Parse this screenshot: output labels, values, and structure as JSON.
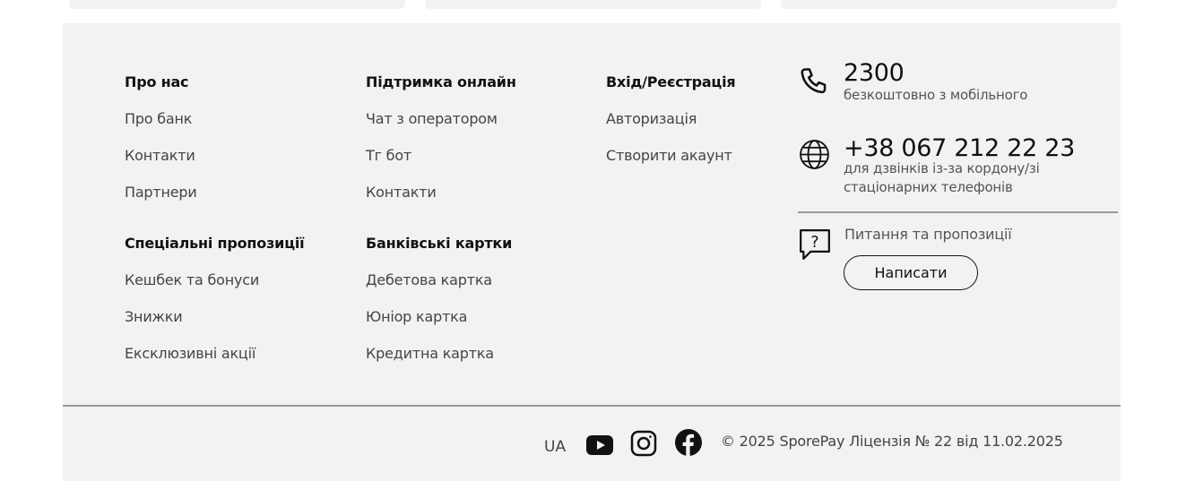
{
  "footer": {
    "columns": [
      {
        "heading": "Про нас",
        "links": [
          "Про банк",
          "Контакти",
          "Партнери"
        ]
      },
      {
        "heading": "Підтримка онлайн",
        "links": [
          "Чат з оператором",
          "Тг бот",
          "Контакти"
        ]
      },
      {
        "heading": "Вхід/Реєстрація",
        "links": [
          "Авторизація",
          "Створити акаунт"
        ]
      },
      {
        "heading": "Спеціальні пропозиції",
        "links": [
          "Кешбек та бонуси",
          "Знижки",
          "Ексклюзивні акції"
        ]
      },
      {
        "heading": "Банківські картки",
        "links": [
          "Дебетова картка",
          "Юніор картка",
          "Кредитна картка"
        ]
      }
    ],
    "contacts": {
      "short_number": "2300",
      "short_number_note": "безкоштовно з мобільного",
      "intl_number": "+38 067 212 22 23",
      "intl_number_note_line1": "для дзвінків із-за кордону/зі",
      "intl_number_note_line2": "стаціонарних телефонів",
      "feedback_label": "Питання та пропозиції",
      "feedback_button": "Написати"
    },
    "bottom": {
      "language": "UA",
      "social": [
        "youtube-icon",
        "instagram-icon",
        "facebook-icon"
      ],
      "copyright": "© 2025 SporePay Ліцензія № 22 від 11.02.2025"
    }
  },
  "colors": {
    "background": "#f2f2f2",
    "text": "#111111",
    "muted_text": "#444444",
    "divider": "#9a9a9a"
  }
}
